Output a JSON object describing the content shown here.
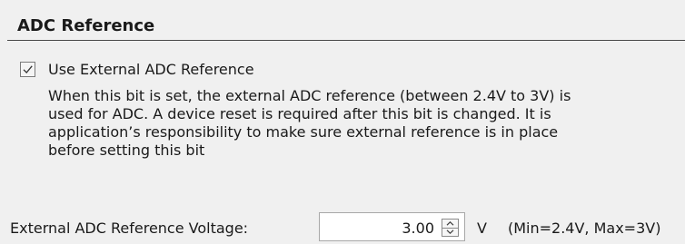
{
  "section": {
    "title": "ADC Reference"
  },
  "use_external": {
    "label": "Use External ADC Reference",
    "checked": true,
    "check_icon": "checkmark-icon"
  },
  "description": "When this bit is set, the external ADC reference (between 2.4V to 3V) is\nused for ADC. A device reset is required after this bit is changed.  It is\napplication’s responsibility to make sure external reference is in place\nbefore setting this bit",
  "voltage": {
    "label": "External ADC Reference Voltage:",
    "value": "3.00",
    "unit": "V",
    "range": "(Min=2.4V, Max=3V)",
    "up_icon": "spin-up-arrow-icon",
    "down_icon": "spin-down-arrow-icon"
  }
}
